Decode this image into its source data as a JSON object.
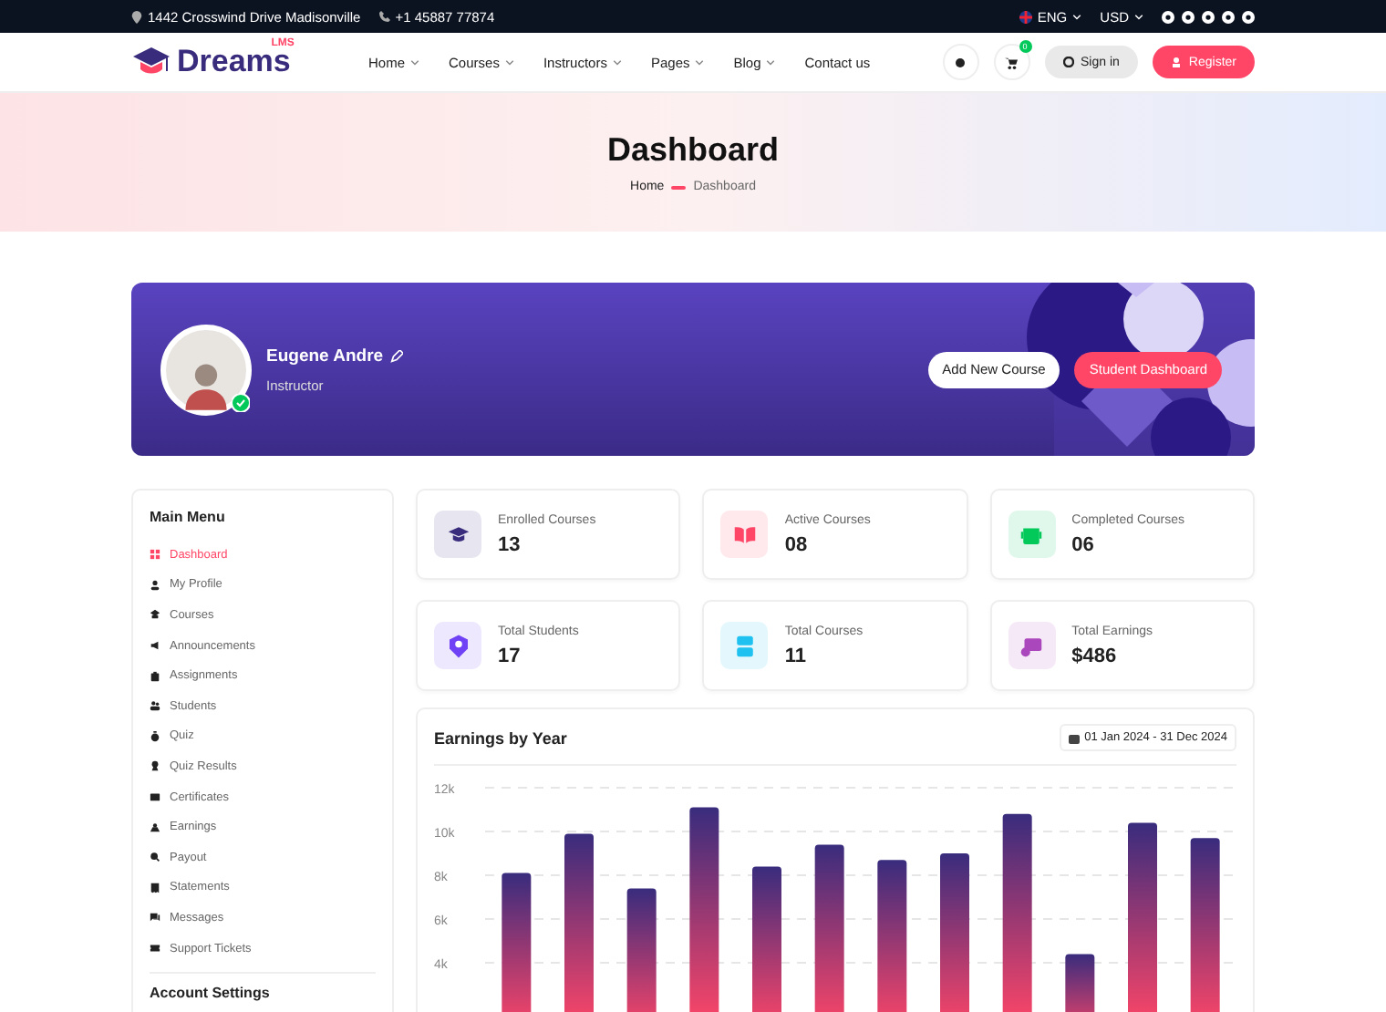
{
  "topbar": {
    "address": "1442 Crosswind Drive Madisonville",
    "phone": "+1 45887 77874",
    "language": "ENG",
    "currency": "USD"
  },
  "header": {
    "logo": "Dreams",
    "logo_sup": "LMS",
    "nav": [
      {
        "label": "Home",
        "dropdown": true
      },
      {
        "label": "Courses",
        "dropdown": true
      },
      {
        "label": "Instructors",
        "dropdown": true
      },
      {
        "label": "Pages",
        "dropdown": true
      },
      {
        "label": "Blog",
        "dropdown": true
      },
      {
        "label": "Contact us",
        "dropdown": false
      }
    ],
    "cart_count": "0",
    "sign_in": "Sign in",
    "register": "Register"
  },
  "hero": {
    "title": "Dashboard",
    "breadcrumb": [
      "Home",
      "Dashboard"
    ]
  },
  "profile": {
    "name": "Eugene Andre",
    "role": "Instructor",
    "online": true,
    "buttons": [
      "Add New Course",
      "Student Dashboard"
    ]
  },
  "sidebar": {
    "title": "Main Menu",
    "items": [
      {
        "label": "Dashboard",
        "selected": true
      },
      {
        "label": "My Profile",
        "selected": false
      },
      {
        "label": "Courses",
        "selected": false
      },
      {
        "label": "Announcements",
        "selected": false
      },
      {
        "label": "Assignments",
        "selected": false
      },
      {
        "label": "Students",
        "selected": false
      },
      {
        "label": "Quiz",
        "selected": false
      },
      {
        "label": "Quiz Results",
        "selected": false
      },
      {
        "label": "Certificates",
        "selected": false
      },
      {
        "label": "Earnings",
        "selected": false
      },
      {
        "label": "Payout",
        "selected": false
      },
      {
        "label": "Statements",
        "selected": false
      },
      {
        "label": "Messages",
        "selected": false
      },
      {
        "label": "Support Tickets",
        "selected": false
      }
    ],
    "section_2": "Account Settings"
  },
  "stats": [
    {
      "label": "Enrolled Courses",
      "value": "13",
      "color": "#392c7d"
    },
    {
      "label": "Active Courses",
      "value": "08",
      "color": "#ff4667"
    },
    {
      "label": "Completed Courses",
      "value": "06",
      "color": "#03c95a"
    },
    {
      "label": "Total Students",
      "value": "17",
      "color": "#6f42f5"
    },
    {
      "label": "Total Courses",
      "value": "11",
      "color": "#1ec1f0"
    },
    {
      "label": "Total Earnings",
      "value": "$486",
      "color": "#ab47bc"
    }
  ],
  "earnings": {
    "date_range": "01 Jan 2024 - 31 Dec 2024",
    "chart_data": {
      "type": "bar",
      "title": "Earnings by Year",
      "values": [
        8100,
        9900,
        7400,
        11100,
        8400,
        9400,
        8700,
        9000,
        10800,
        4400,
        10400,
        9700
      ],
      "ylim": [
        0,
        12000
      ],
      "grid": true,
      "yticks": [
        {
          "value": 4000,
          "label": "4k"
        },
        {
          "value": 6000,
          "label": "6k"
        },
        {
          "value": 8000,
          "label": "8k"
        },
        {
          "value": 10000,
          "label": "10k"
        },
        {
          "value": 12000,
          "label": "12k"
        }
      ]
    }
  }
}
